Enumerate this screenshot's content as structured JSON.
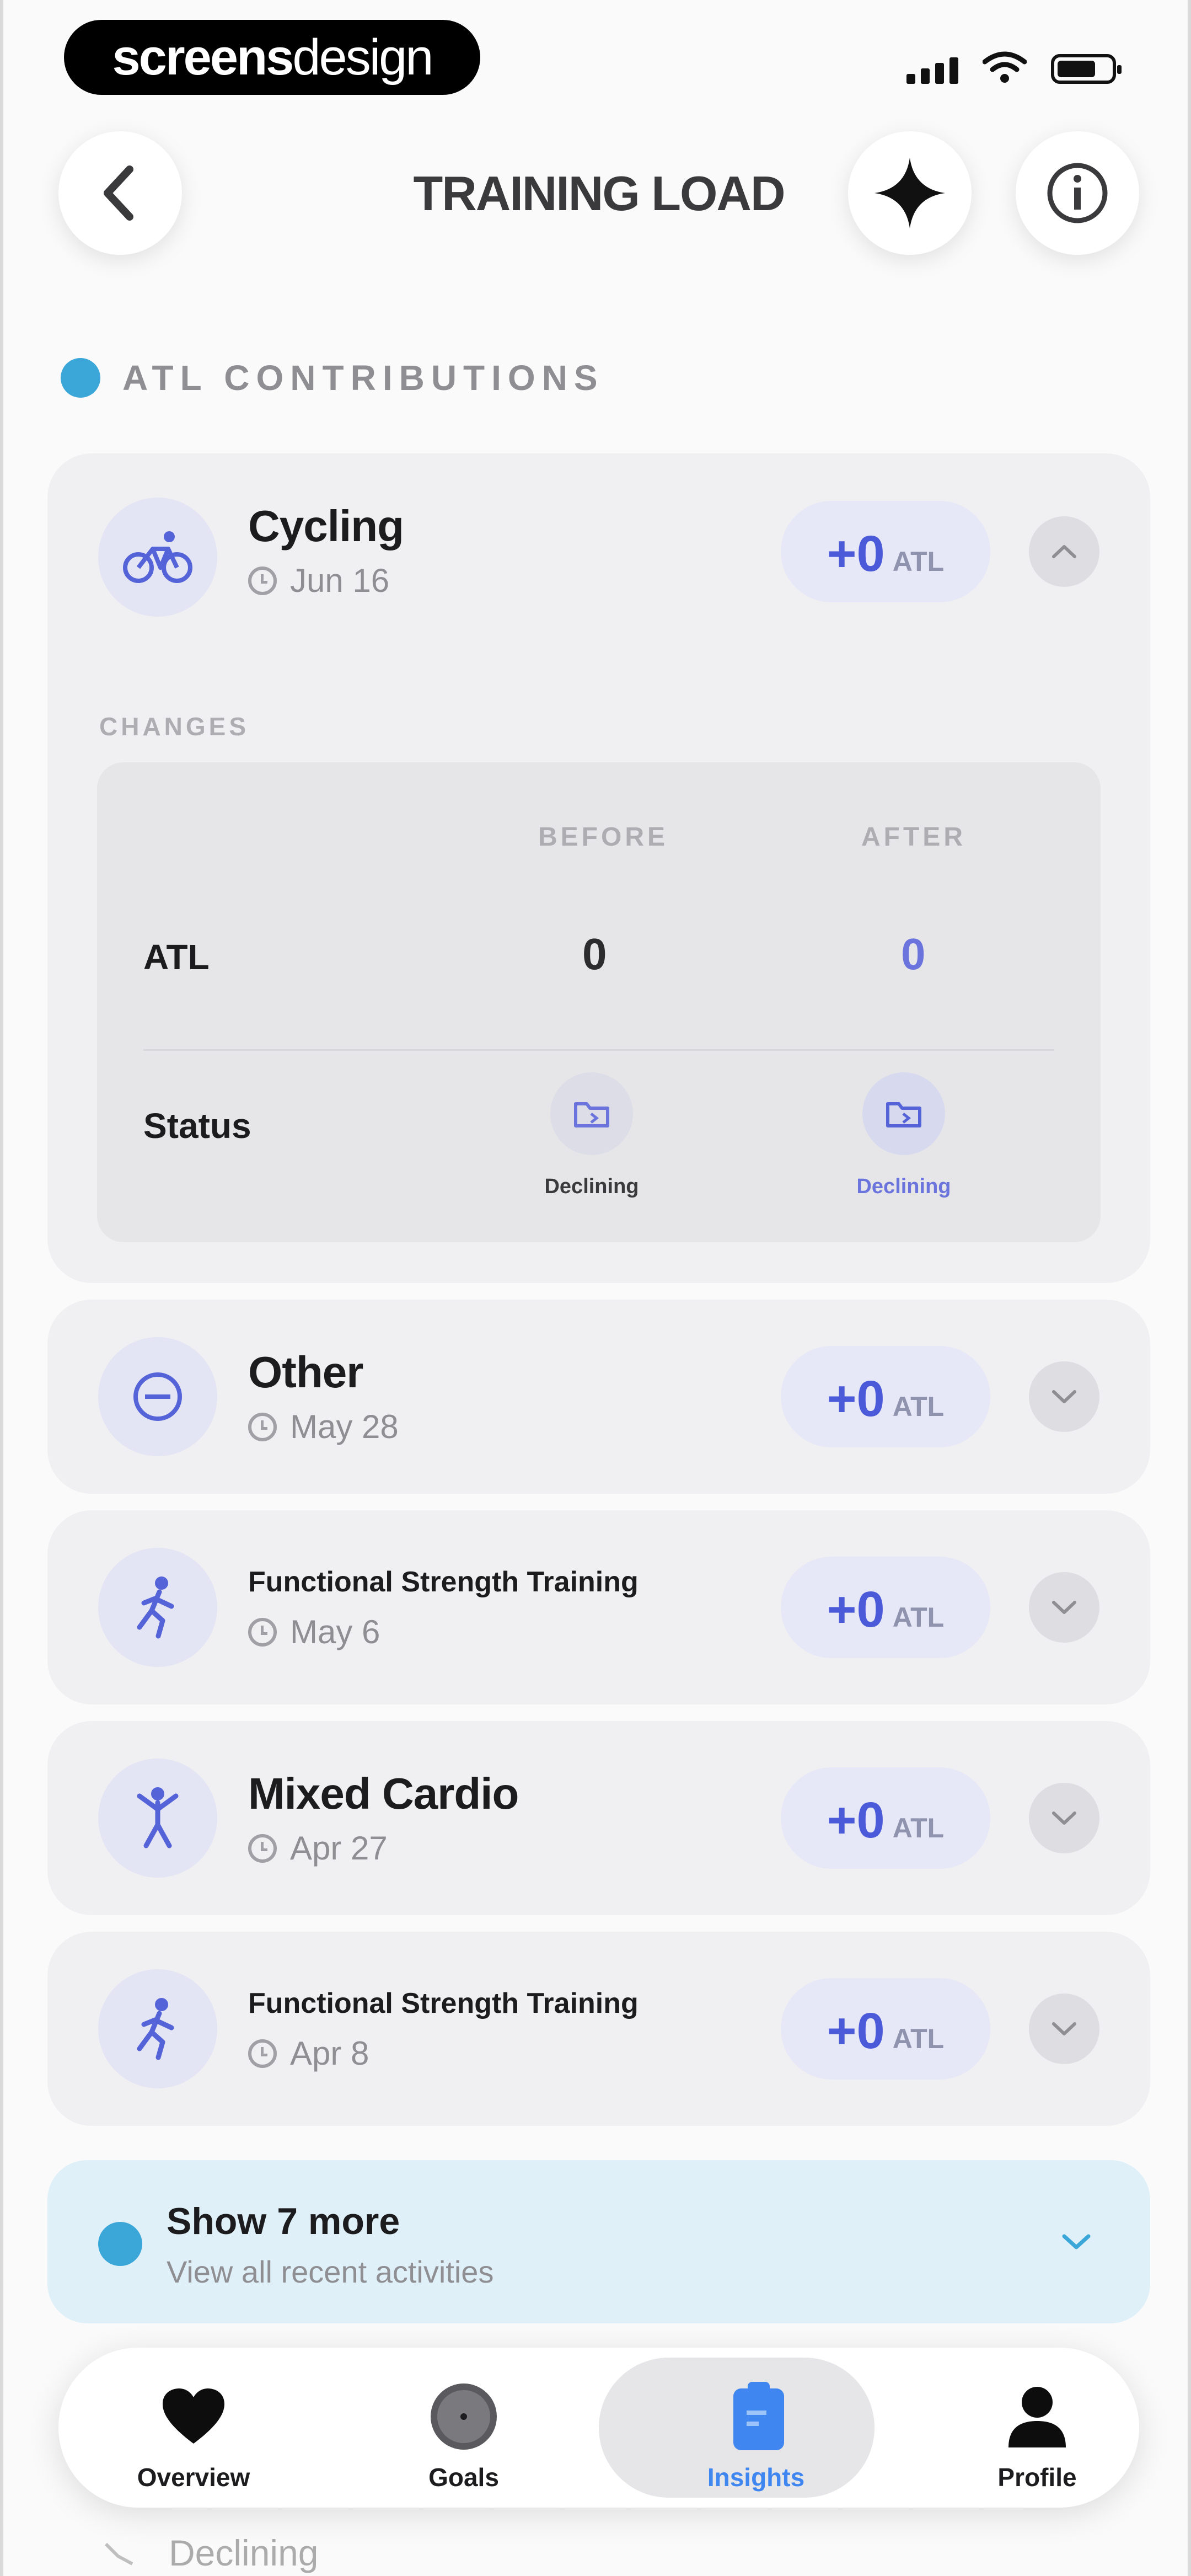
{
  "status_bar": {
    "brand_bold": "screens",
    "brand_light": "design"
  },
  "header": {
    "title": "TRAINING LOAD",
    "back_icon": "chevron-left-icon",
    "ai_icon": "sparkle-icon",
    "info_icon": "info-icon"
  },
  "section": {
    "label": "ATL CONTRIBUTIONS"
  },
  "activities": [
    {
      "title": "Cycling",
      "date": "Jun 16",
      "icon": "bicycle-icon",
      "atl_value": "+0",
      "atl_unit": "ATL",
      "expanded": true
    },
    {
      "title": "Other",
      "date": "May 28",
      "icon": "other-activity-icon",
      "atl_value": "+0",
      "atl_unit": "ATL",
      "expanded": false
    },
    {
      "title": "Functional Strength Training",
      "date": "May 6",
      "icon": "strength-training-icon",
      "atl_value": "+0",
      "atl_unit": "ATL",
      "expanded": false
    },
    {
      "title": "Mixed Cardio",
      "date": "Apr 27",
      "icon": "mixed-cardio-icon",
      "atl_value": "+0",
      "atl_unit": "ATL",
      "expanded": false
    },
    {
      "title": "Functional Strength Training",
      "date": "Apr 8",
      "icon": "strength-training-icon",
      "atl_value": "+0",
      "atl_unit": "ATL",
      "expanded": false
    }
  ],
  "changes": {
    "label": "CHANGES",
    "col_before": "BEFORE",
    "col_after": "AFTER",
    "atl_label": "ATL",
    "atl_before": "0",
    "atl_after": "0",
    "status_label": "Status",
    "status_before": "Declining",
    "status_after": "Declining"
  },
  "show_more": {
    "title": "Show 7 more",
    "subtitle": "View all recent activities"
  },
  "bleed": {
    "status": "Declining"
  },
  "tabs": [
    {
      "label": "Overview",
      "icon": "heart-icon"
    },
    {
      "label": "Goals",
      "icon": "target-icon"
    },
    {
      "label": "Insights",
      "icon": "clipboard-icon",
      "active": true
    },
    {
      "label": "Profile",
      "icon": "person-icon"
    }
  ],
  "colors": {
    "accent": "#4a5ad8",
    "info_blue": "#3ba7d9",
    "active_tab": "#3f86f0"
  }
}
